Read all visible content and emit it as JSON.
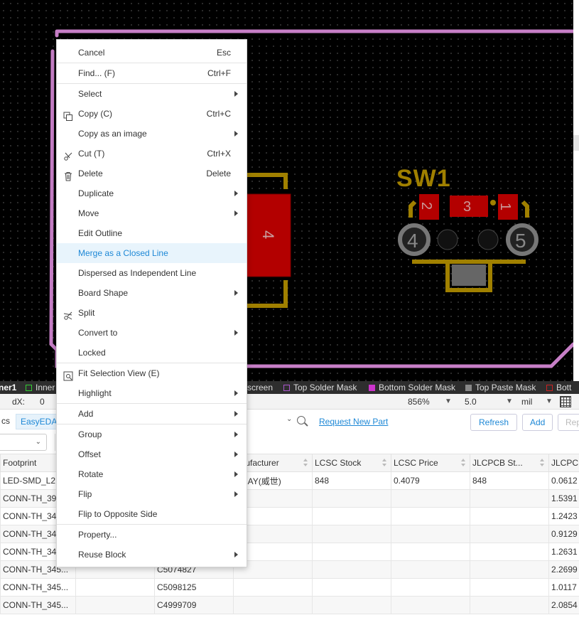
{
  "canvas": {
    "component_label": "SW1",
    "left_pad_number": "4",
    "pads": [
      {
        "label": "2"
      },
      {
        "label": "3"
      },
      {
        "label": "1"
      }
    ],
    "holes": [
      {
        "label": "4"
      },
      {
        "label": "5"
      }
    ],
    "colors": {
      "outline": "#c77fc7",
      "pad": "#b30000",
      "silk": "#a08000",
      "background": "#000000"
    }
  },
  "layer_bar": {
    "tabs": [
      {
        "label": "ner1",
        "color": ""
      },
      {
        "label": "Inner",
        "color": "#33cc33"
      },
      {
        "label": "screen",
        "color": ""
      },
      {
        "label": "Top Solder Mask",
        "color": "#aa55cc"
      },
      {
        "label": "Bottom Solder Mask",
        "color": "#cc33cc"
      },
      {
        "label": "Top Paste Mask",
        "color": "#888888"
      },
      {
        "label": "Bott",
        "color": "#cc2222"
      }
    ]
  },
  "status_bar": {
    "dx_label": "dX:",
    "dx_value": "0",
    "zoom": "856%",
    "grid_value": "5.0",
    "unit": "mil"
  },
  "library": {
    "tab_symbols": "cs",
    "tab_easyeda": "EasyEDA",
    "request_link": "Request New Part",
    "refresh_label": "Refresh",
    "add_label": "Add",
    "rep_label": "Rep"
  },
  "table": {
    "headers": [
      "Footprint",
      "",
      "",
      "anufacturer",
      "LCSC Stock",
      "LCSC Price",
      "JLCPCB St...",
      "JLCPC"
    ],
    "rows": [
      [
        "LED-SMD_L2.",
        "",
        "",
        "SHAY(威世)",
        "848",
        "0.4079",
        "848",
        "0.0612"
      ],
      [
        "CONN-TH_39",
        "",
        "",
        "",
        "",
        "",
        "",
        "1.5391"
      ],
      [
        "CONN-TH_34",
        "",
        "",
        "",
        "",
        "",
        "",
        "1.2423"
      ],
      [
        "CONN-TH_34",
        "",
        "",
        "",
        "",
        "",
        "",
        "0.9129"
      ],
      [
        "CONN-TH_34",
        "",
        "",
        "",
        "",
        "",
        "",
        "1.2631"
      ],
      [
        "CONN-TH_345...",
        "",
        "C5074827",
        "",
        "",
        "",
        "",
        "2.2699"
      ],
      [
        "CONN-TH_345...",
        "",
        "C5098125",
        "",
        "",
        "",
        "",
        "1.0117"
      ],
      [
        "CONN-TH_345...",
        "",
        "C4999709",
        "",
        "",
        "",
        "",
        "2.0854"
      ]
    ]
  },
  "context_menu": {
    "items": [
      {
        "label": "Cancel",
        "shortcut": "Esc"
      },
      {
        "sep": true
      },
      {
        "label": "Find... (F)",
        "shortcut": "Ctrl+F"
      },
      {
        "sep": true
      },
      {
        "label": "Select",
        "submenu": true
      },
      {
        "label": "Copy (C)",
        "shortcut": "Ctrl+C",
        "icon": "copy-icon"
      },
      {
        "label": "Copy as an image",
        "submenu": true
      },
      {
        "label": "Cut (T)",
        "shortcut": "Ctrl+X",
        "icon": "scissors-icon"
      },
      {
        "label": "Delete",
        "shortcut": "Delete",
        "icon": "trash-icon"
      },
      {
        "label": "Duplicate",
        "submenu": true
      },
      {
        "label": "Move",
        "submenu": true
      },
      {
        "label": "Edit Outline"
      },
      {
        "label": "Merge as a Closed Line",
        "highlight": true
      },
      {
        "label": "Dispersed as Independent Line"
      },
      {
        "label": "Board Shape",
        "submenu": true
      },
      {
        "label": "Split",
        "icon": "split-icon"
      },
      {
        "label": "Convert to",
        "submenu": true
      },
      {
        "label": "Locked"
      },
      {
        "sep": true
      },
      {
        "label": "Fit Selection View (E)",
        "icon": "fit-view-icon"
      },
      {
        "label": "Highlight",
        "submenu": true
      },
      {
        "sep": true
      },
      {
        "label": "Add",
        "submenu": true
      },
      {
        "sep": true
      },
      {
        "label": "Group",
        "submenu": true
      },
      {
        "label": "Offset",
        "submenu": true
      },
      {
        "label": "Rotate",
        "submenu": true
      },
      {
        "label": "Flip",
        "submenu": true
      },
      {
        "label": "Flip to Opposite Side"
      },
      {
        "sep": true
      },
      {
        "label": "Property..."
      },
      {
        "label": "Reuse Block",
        "submenu": true
      }
    ]
  }
}
